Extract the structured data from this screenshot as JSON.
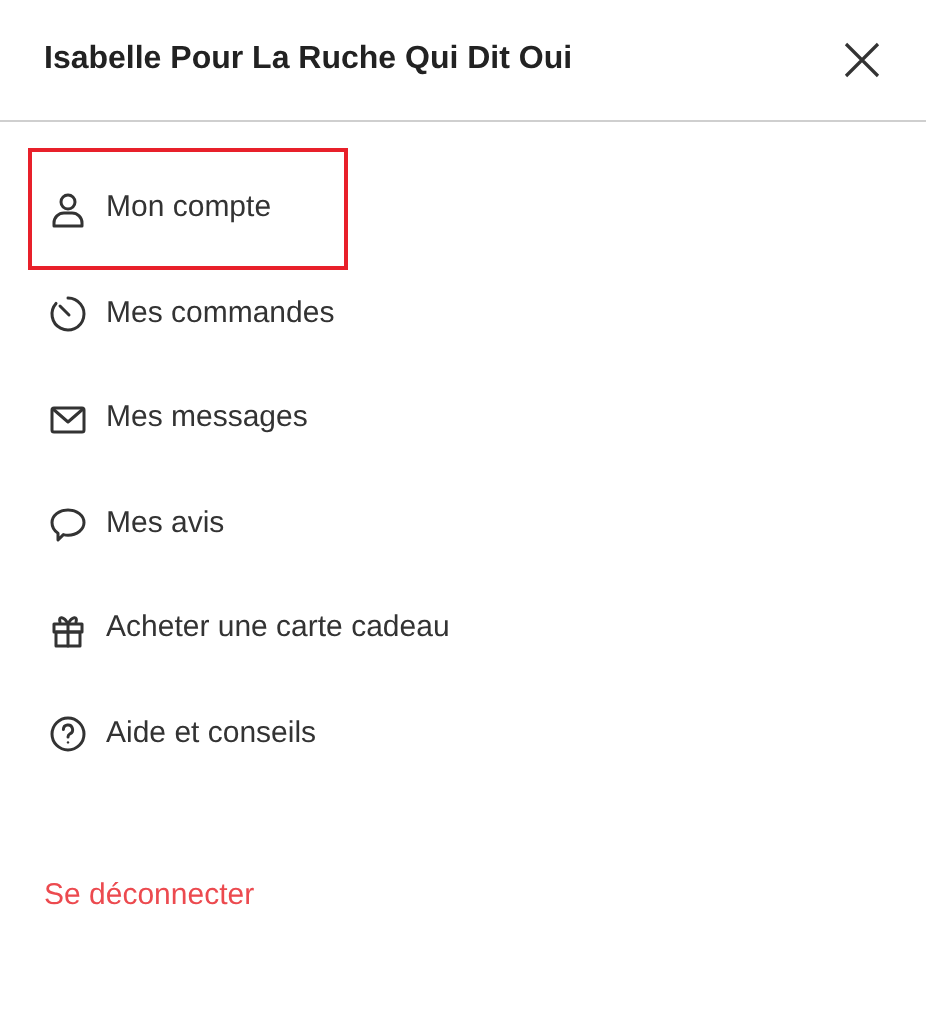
{
  "header": {
    "title": "Isabelle Pour La Ruche Qui Dit Oui"
  },
  "menu": [
    {
      "label": "Mon compte",
      "selected": true
    },
    {
      "label": "Mes commandes",
      "selected": false
    },
    {
      "label": "Mes messages",
      "selected": false
    },
    {
      "label": "Mes avis",
      "selected": false
    },
    {
      "label": "Acheter une carte cadeau",
      "selected": false
    },
    {
      "label": "Aide et conseils",
      "selected": false
    }
  ],
  "logout": {
    "label": "Se déconnecter"
  }
}
